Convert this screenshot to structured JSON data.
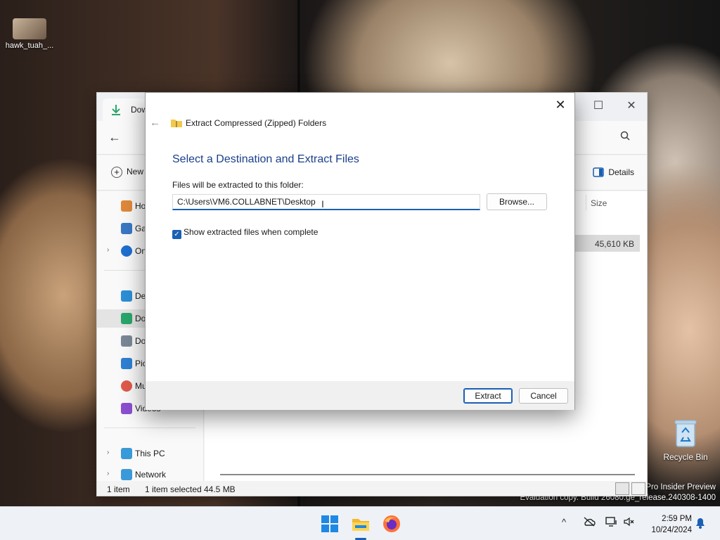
{
  "desktop": {
    "top_icon_label": "hawk_tuah_...",
    "recycle_bin_label": "Recycle Bin",
    "watermark_line1": "Pro Insider Preview",
    "watermark_line2": "Evaluation copy. Build 26080.ge_release.240308-1400"
  },
  "explorer": {
    "tab_label": "Dow",
    "new_label": "New",
    "details_label": "Details",
    "column_size": "Size",
    "selected_row_size": "45,610 KB",
    "nav": [
      {
        "label": "Ho",
        "icon": "home-icon",
        "color": "#e0893a"
      },
      {
        "label": "Ga",
        "icon": "gallery-icon",
        "color": "#3a78c4"
      },
      {
        "label": "On",
        "icon": "onedrive-icon",
        "color": "#1e6fd0"
      },
      {
        "label": "De",
        "icon": "desktop-icon",
        "color": "#2d8fd6"
      },
      {
        "label": "Do",
        "icon": "downloads-icon",
        "color": "#2aa66b"
      },
      {
        "label": "Do",
        "icon": "documents-icon",
        "color": "#7a8796"
      },
      {
        "label": "Pic",
        "icon": "pictures-icon",
        "color": "#2f7fd2"
      },
      {
        "label": "Mu",
        "icon": "music-icon",
        "color": "#e0594a"
      },
      {
        "label": "Videos",
        "icon": "videos-icon",
        "color": "#8b4fd0"
      },
      {
        "label": "This PC",
        "icon": "this-pc-icon",
        "color": "#3a9ad9"
      },
      {
        "label": "Network",
        "icon": "network-icon",
        "color": "#3a9ad9"
      }
    ],
    "status": {
      "count": "1 item",
      "selected": "1 item selected",
      "size": "44.5 MB"
    }
  },
  "dialog": {
    "title": "Extract Compressed (Zipped) Folders",
    "heading": "Select a Destination and Extract Files",
    "folder_label": "Files will be extracted to this folder:",
    "path_value": "C:\\Users\\VM6.COLLABNET\\Desktop",
    "browse_label": "Browse...",
    "checkbox_label": "Show extracted files when complete",
    "checkbox_checked": true,
    "extract_label": "Extract",
    "cancel_label": "Cancel",
    "accent_color": "#1a5fb4"
  },
  "taskbar": {
    "time": "2:59 PM",
    "date": "10/24/2024",
    "pinned": [
      "start-icon",
      "file-explorer-icon",
      "firefox-icon"
    ]
  }
}
